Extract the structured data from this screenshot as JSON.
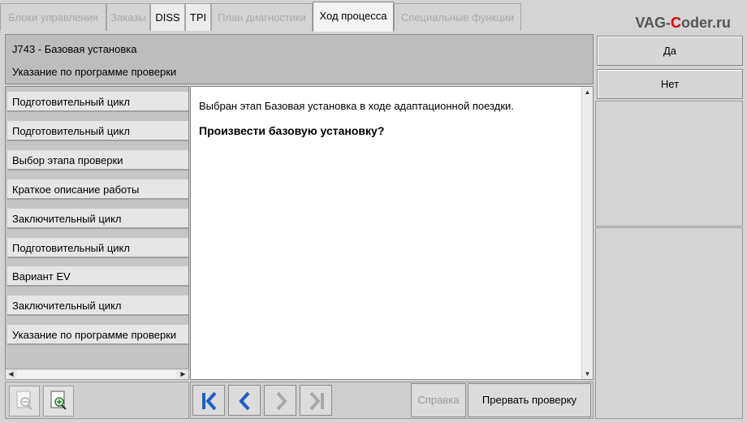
{
  "tabs": [
    {
      "label": "Блоки управления",
      "state": "disabled"
    },
    {
      "label": "Заказы",
      "state": "disabled"
    },
    {
      "label": "DISS",
      "state": "enabled"
    },
    {
      "label": "TPI",
      "state": "enabled"
    },
    {
      "label": "План диагностики",
      "state": "disabled"
    },
    {
      "label": "Ход процесса",
      "state": "active"
    },
    {
      "label": "Специальные функции",
      "state": "disabled"
    }
  ],
  "watermark": {
    "part1": "VAG-",
    "part2": "C",
    "part3": "oder.ru"
  },
  "header": {
    "line1": "J743 - Базовая установка",
    "line2": "Указание по программе проверки"
  },
  "side_buttons": {
    "yes": "Да",
    "no": "Нет"
  },
  "steps": [
    "Подготовительный цикл",
    "Подготовительный цикл",
    "Выбор этапа проверки",
    "Краткое описание работы",
    "Заключительный цикл",
    "Подготовительный цикл",
    "Вариант EV",
    "Заключительный цикл",
    "Указание по программе проверки"
  ],
  "content": {
    "text": "Выбран этап Базовая установка в ходе адаптационной поездки.",
    "question": "Произвести базовую установку?"
  },
  "bottom": {
    "help_label": "Справка",
    "abort_label": "Прервать проверку"
  },
  "colors": {
    "nav_active": "#1f5fc8",
    "nav_disabled": "#a8a8a8",
    "watermark_accent": "#d40000"
  },
  "icons": {
    "zoom_out": "zoom-out-icon",
    "zoom_in": "zoom-in-icon",
    "first": "first-page-icon",
    "prev": "previous-icon",
    "next": "next-icon",
    "last": "last-page-icon"
  }
}
